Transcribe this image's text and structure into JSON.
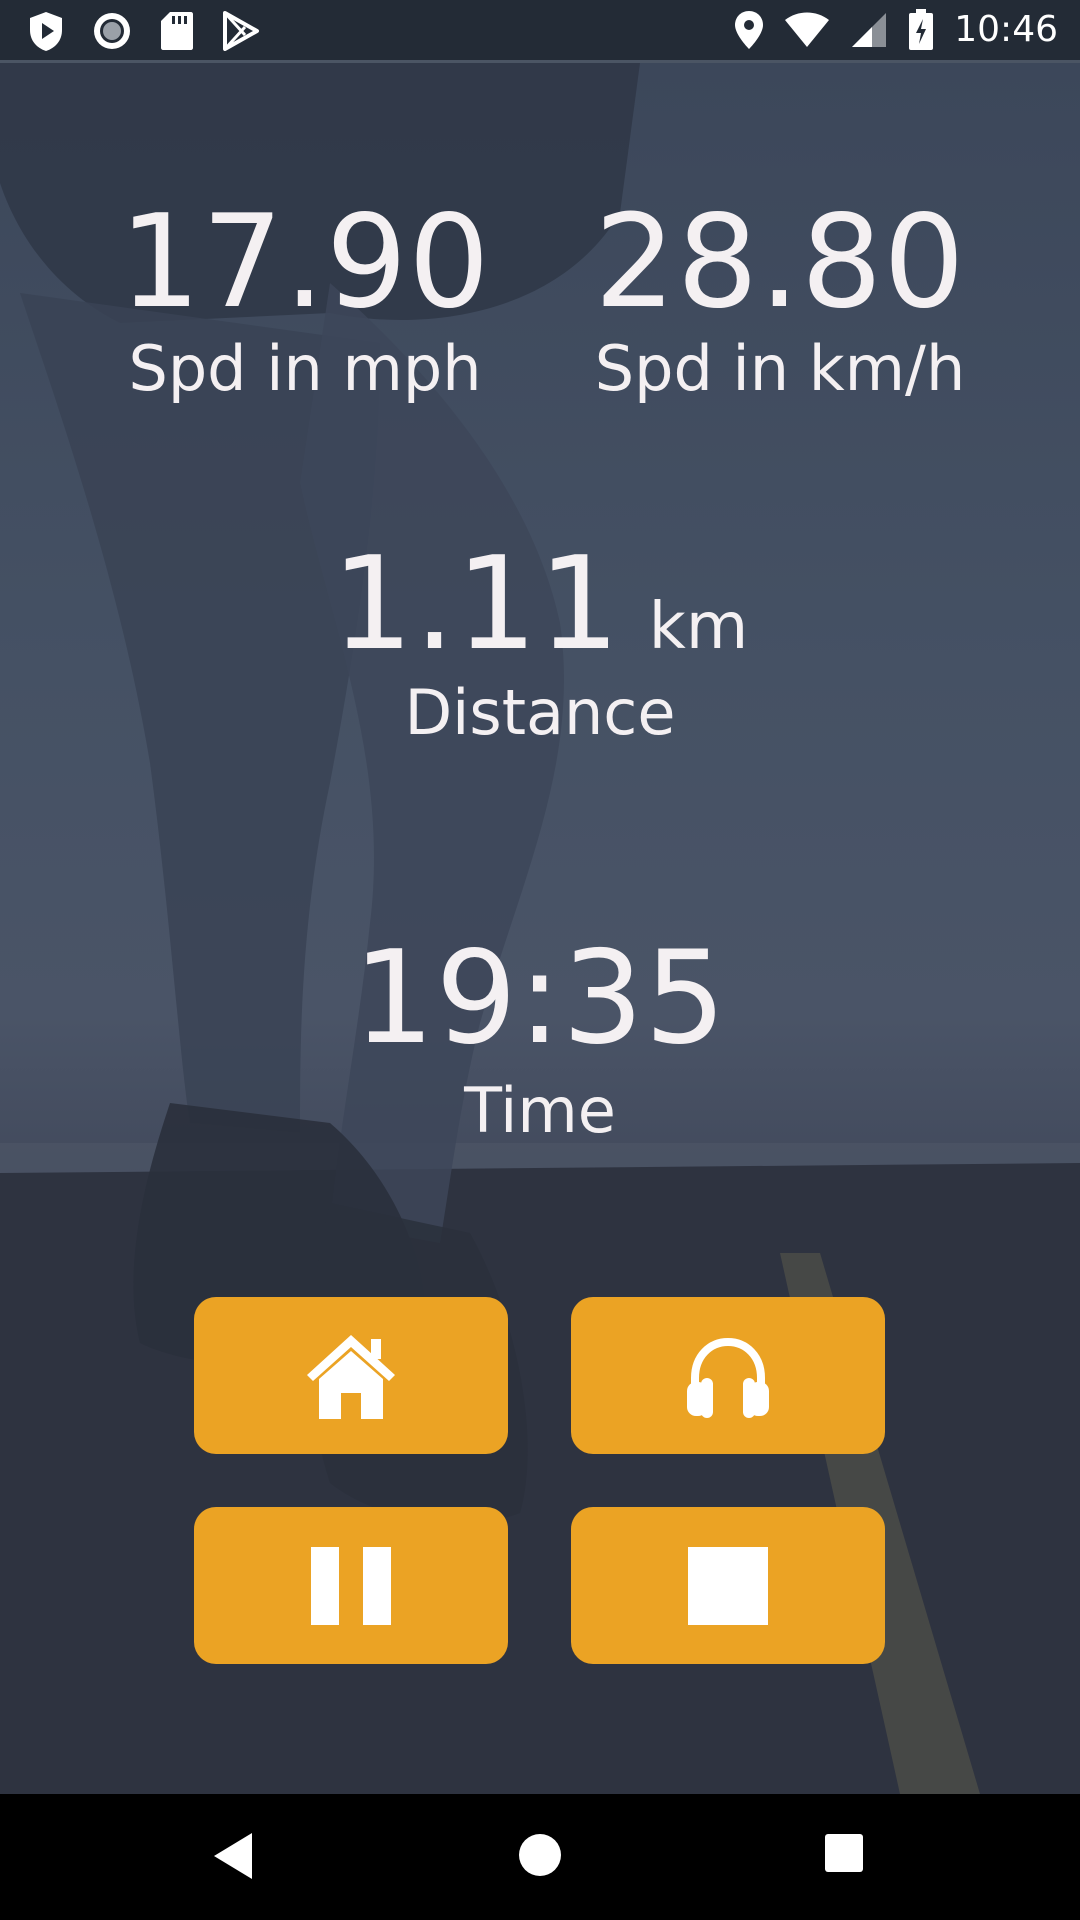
{
  "status_bar": {
    "time": "10:46",
    "left_icons": [
      "shield-play-icon",
      "radio-icon",
      "sd-card-icon",
      "play-store-icon"
    ],
    "right_icons": [
      "location-icon",
      "wifi-icon",
      "signal-icon",
      "battery-charging-icon"
    ]
  },
  "metrics": {
    "speed_mph": {
      "value": "17.90",
      "label": "Spd in mph"
    },
    "speed_kmh": {
      "value": "28.80",
      "label": "Spd in km/h"
    },
    "distance": {
      "value": "1.11",
      "unit": "km",
      "label": "Distance"
    },
    "time": {
      "value": "19:35",
      "label": "Time"
    }
  },
  "controls": [
    {
      "name": "home",
      "icon": "home-icon"
    },
    {
      "name": "music",
      "icon": "headphones-icon"
    },
    {
      "name": "pause",
      "icon": "pause-icon"
    },
    {
      "name": "stop",
      "icon": "stop-icon"
    }
  ],
  "colors": {
    "accent": "#eba324",
    "text": "#f4f0f2",
    "status_bar": "#232b36",
    "nav_bar": "#000000"
  },
  "nav_bar": {
    "buttons": [
      "back-icon",
      "home-circle-icon",
      "recents-icon"
    ]
  }
}
